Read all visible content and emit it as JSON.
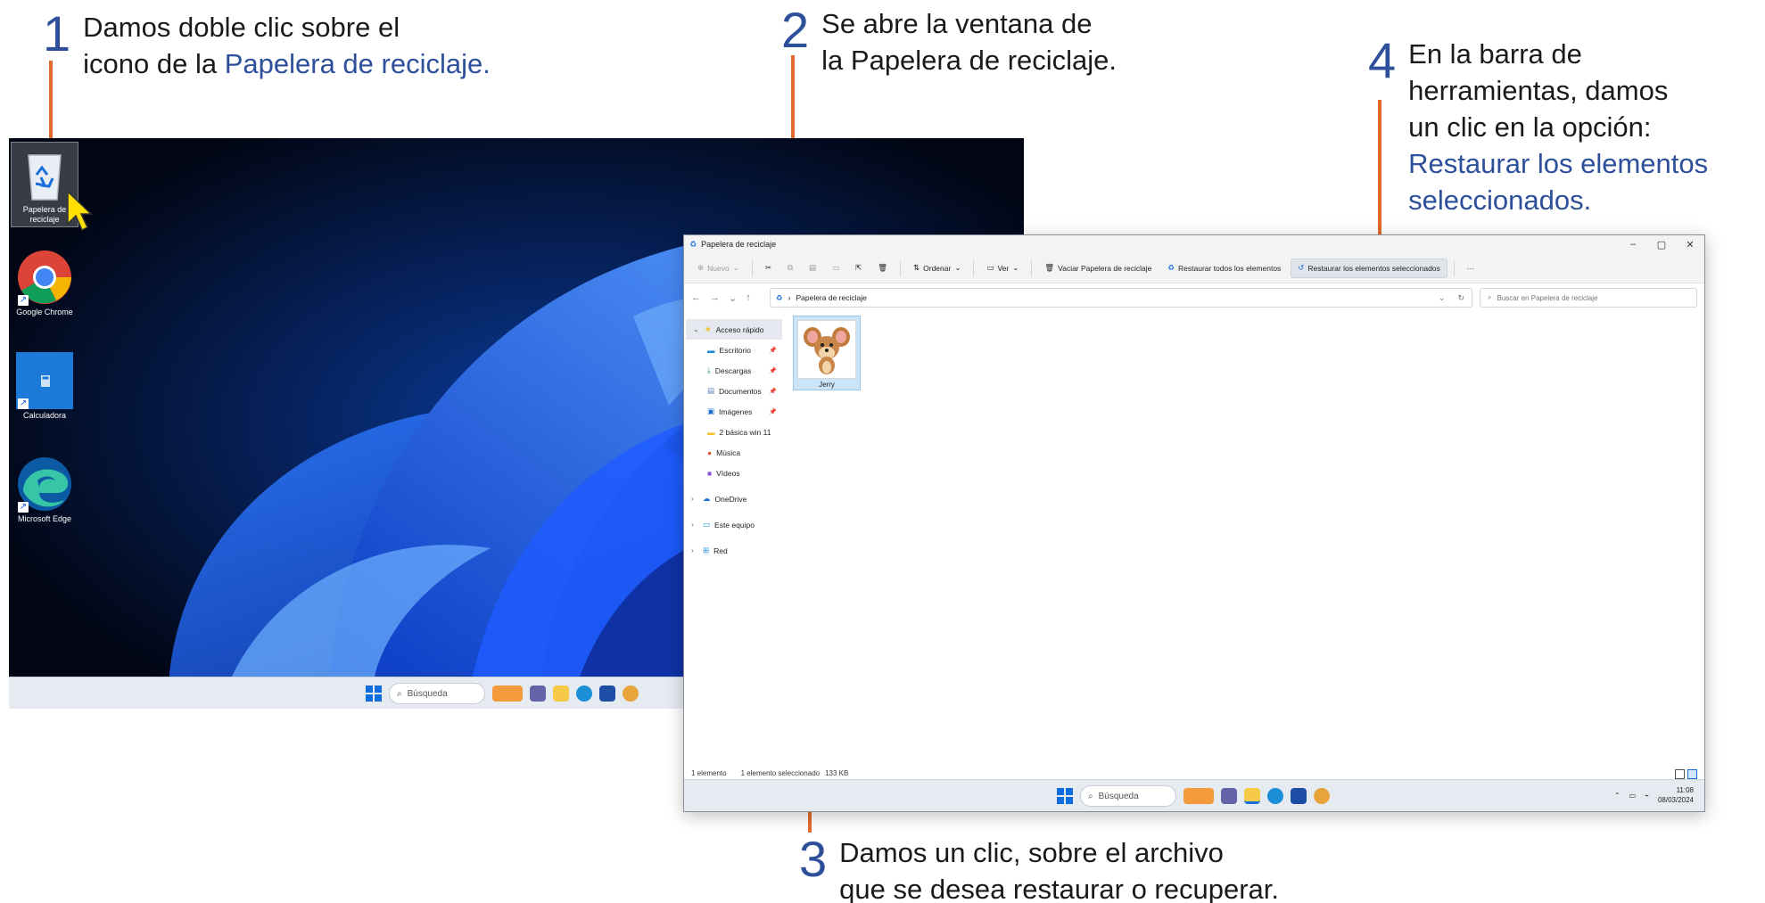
{
  "steps": [
    {
      "num": "1",
      "line1": "Damos doble clic sobre el",
      "line2_pre": "icono de la ",
      "line2_hl": "Papelera de reciclaje."
    },
    {
      "num": "2",
      "line1": "Se abre la ventana de",
      "line2": "la Papelera de reciclaje."
    },
    {
      "num": "3",
      "line1": "Damos un clic, sobre el archivo",
      "line2": "que se desea restaurar o recuperar."
    },
    {
      "num": "4",
      "line1": "En la barra de",
      "line2": "herramientas, damos",
      "line3": "un clic en la opción:",
      "line4_hl": "Restaurar los elementos",
      "line5_hl": "seleccionados."
    }
  ],
  "colors": {
    "accent_text": "#2e4f99",
    "connector": "#e06c2c",
    "selection": "#cce4f7"
  },
  "desktop": {
    "icons": [
      {
        "label": "Papelera de reciclaje",
        "icon": "recycle-bin-icon"
      },
      {
        "label": "Google Chrome",
        "icon": "chrome-icon"
      },
      {
        "label": "Calculadora",
        "icon": "calculator-icon"
      },
      {
        "label": "Microsoft Edge",
        "icon": "edge-icon"
      }
    ],
    "taskbar": {
      "search": "Búsqueda"
    }
  },
  "explorer": {
    "title": "Papelera de reciclaje",
    "toolbar": {
      "new": "Nuevo",
      "sort": "Ordenar",
      "view": "Ver",
      "empty": "Vaciar Papelera de reciclaje",
      "restore_all": "Restaurar todos los elementos",
      "restore_selected": "Restaurar los elementos seleccionados",
      "more": "···"
    },
    "address": {
      "path": "Papelera de reciclaje",
      "search_placeholder": "Buscar en Papelera de reciclaje"
    },
    "nav": {
      "quick_access": "Acceso rápido",
      "items": [
        "Escritorio",
        "Descargas",
        "Documentos",
        "Imágenes",
        "2 básica win 11",
        "Música",
        "Vídeos"
      ],
      "onedrive": "OneDrive",
      "this_pc": "Este equipo",
      "network": "Red"
    },
    "files": [
      {
        "name": "Jerry"
      }
    ],
    "status": {
      "count": "1 elemento",
      "selected": "1 elemento seleccionado",
      "size": "133 KB"
    },
    "taskbar": {
      "search": "Búsqueda",
      "time": "11:08",
      "date": "08/03/2024"
    }
  }
}
